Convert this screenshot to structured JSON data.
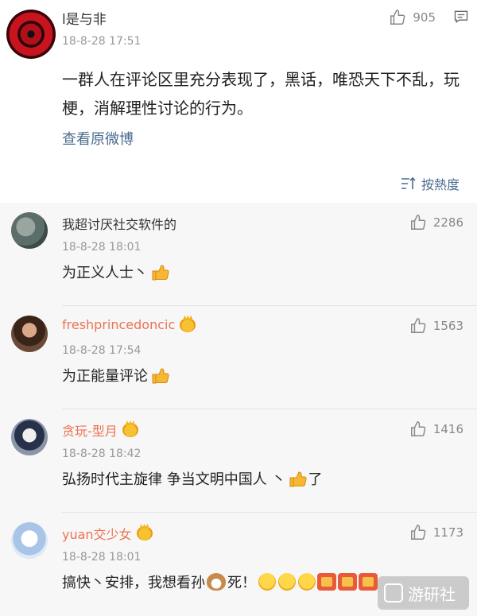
{
  "post": {
    "author": "l是与非",
    "time": "18-8-28 17:51",
    "likes": "905",
    "content": "一群人在评论区里充分表现了，黑话，唯恐天下不乱，玩梗，消解理性讨论的行为。",
    "view_original": "查看原微博",
    "sort_label": "按熱度"
  },
  "comments": [
    {
      "author": "我超讨厌社交软件的",
      "time": "18-8-28 18:01",
      "likes": "2286",
      "text": "为正义人士丶"
    },
    {
      "author": "freshprincedoncic",
      "time": "18-8-28 17:54",
      "likes": "1563",
      "text": "为正能量评论"
    },
    {
      "author": "贪玩-型月",
      "time": "18-8-28 18:42",
      "likes": "1416",
      "text": "弘扬时代主旋律 争当文明中国人 丶",
      "text_after": " 了"
    },
    {
      "author": "yuan交少女",
      "time": "18-8-28 18:01",
      "likes": "1173",
      "text": "搞快丶安排，我想看孙",
      "text_after": "死！"
    }
  ],
  "watermark": {
    "label": "游研社"
  },
  "colors": {
    "link": "#4a6c8f",
    "orange_name": "#eb7350",
    "list_bg": "#f7f7f7"
  },
  "icons": {
    "like": "thumbs-up-icon",
    "message": "message-icon",
    "sort": "sort-icon"
  }
}
